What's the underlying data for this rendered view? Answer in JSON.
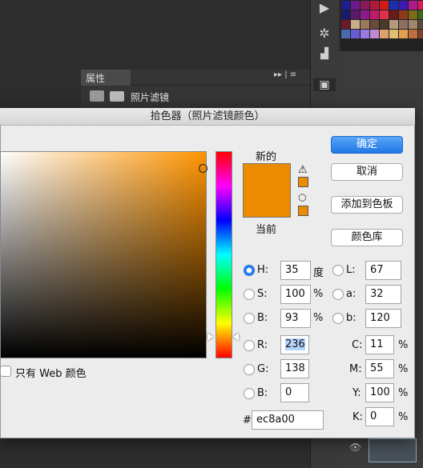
{
  "properties_panel": {
    "tab_label": "属性",
    "row_label": "照片滤镜"
  },
  "dialog": {
    "title": "拾色器（照片滤镜颜色）",
    "new_label": "新的",
    "current_label": "当前",
    "web_only_label": "只有 Web 颜色",
    "buttons": {
      "ok": "确定",
      "cancel": "取消",
      "add_to_swatches": "添加到色板",
      "color_libraries": "颜色库"
    },
    "fields": {
      "H": {
        "label": "H:",
        "value": "35",
        "unit": "度"
      },
      "S": {
        "label": "S:",
        "value": "100",
        "unit": "%"
      },
      "Bv": {
        "label": "B:",
        "value": "93",
        "unit": "%"
      },
      "R": {
        "label": "R:",
        "value": "236"
      },
      "G": {
        "label": "G:",
        "value": "138"
      },
      "Bc": {
        "label": "B:",
        "value": "0"
      },
      "L": {
        "label": "L:",
        "value": "67"
      },
      "a": {
        "label": "a:",
        "value": "32"
      },
      "b": {
        "label": "b:",
        "value": "120"
      },
      "C": {
        "label": "C:",
        "value": "11",
        "unit": "%"
      },
      "M": {
        "label": "M:",
        "value": "55",
        "unit": "%"
      },
      "Y": {
        "label": "Y:",
        "value": "100",
        "unit": "%"
      },
      "K": {
        "label": "K:",
        "value": "0",
        "unit": "%"
      },
      "hex": {
        "label": "#",
        "value": "ec8a00"
      }
    },
    "selected_radio": "H",
    "colors": {
      "new": "#ec8a00",
      "current": "#ec8a00",
      "accent": "#1f78e6"
    }
  },
  "icons": [
    "warning-icon",
    "cube-icon",
    "camera-icon",
    "filter-icon",
    "settings-icon",
    "histogram-icon",
    "eye-icon"
  ]
}
